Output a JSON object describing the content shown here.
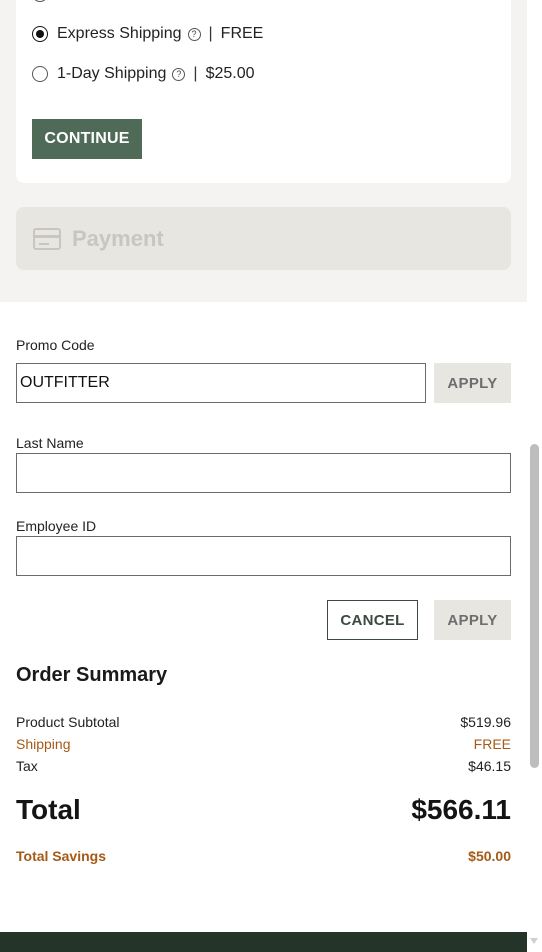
{
  "shipping": {
    "options": [
      {
        "name": "Express Shipping",
        "separator": "|",
        "price": "FREE",
        "selected": true
      },
      {
        "name": "1-Day Shipping",
        "separator": "|",
        "price": "$25.00",
        "selected": false
      }
    ],
    "help_glyph": "?",
    "continue_label": "CONTINUE"
  },
  "payment": {
    "icon": "credit-card-icon",
    "label": "Payment"
  },
  "promo": {
    "label": "Promo Code",
    "value": "OUTFITTER",
    "apply_label": "APPLY"
  },
  "employee": {
    "last_name_label": "Last Name",
    "last_name_value": "",
    "employee_id_label": "Employee ID",
    "employee_id_value": "",
    "cancel_label": "CANCEL",
    "apply_label": "APPLY"
  },
  "summary": {
    "title": "Order Summary",
    "rows": [
      {
        "label": "Product Subtotal",
        "value": "$519.96"
      },
      {
        "label": "Shipping",
        "value": "FREE"
      },
      {
        "label": "Tax",
        "value": "$46.15"
      }
    ],
    "total_label": "Total",
    "total_value": "$566.11",
    "savings_label": "Total Savings",
    "savings_value": "$50.00"
  },
  "colors": {
    "primary_button": "#4f6a56",
    "accent": "#a55a17",
    "footer": "#243428"
  }
}
